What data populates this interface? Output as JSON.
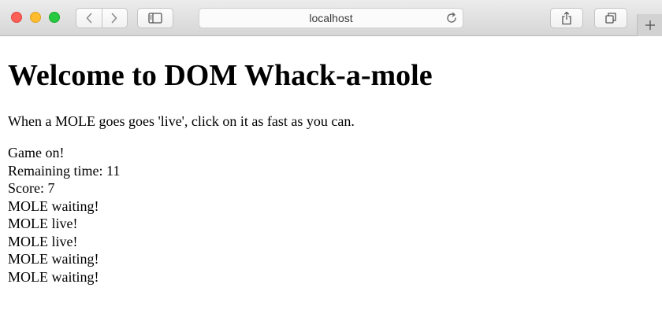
{
  "browser": {
    "address": "localhost",
    "icons": {
      "back": "chevron-left-icon",
      "forward": "chevron-right-icon",
      "sidebar": "sidebar-icon",
      "reload": "reload-icon",
      "share": "share-icon",
      "tabs": "tabs-overview-icon",
      "new_tab": "plus-icon"
    }
  },
  "page": {
    "title": "Welcome to DOM Whack-a-mole",
    "intro": "When a MOLE goes goes 'live', click on it as fast as you can.",
    "status": "Game on!",
    "remaining_time": "Remaining time: 11",
    "score": "Score: 7",
    "moles": [
      "MOLE waiting!",
      "MOLE live!",
      "MOLE live!",
      "MOLE waiting!",
      "MOLE waiting!"
    ]
  }
}
